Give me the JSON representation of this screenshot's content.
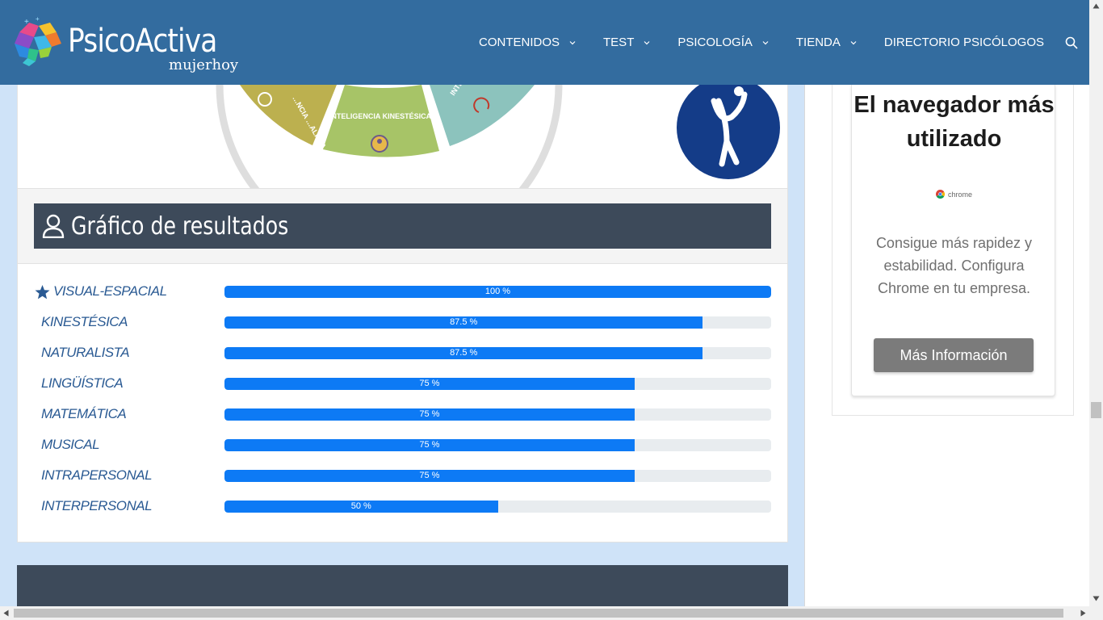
{
  "header": {
    "logo_text": "PsicoActiva",
    "logo_sub": "mujerhoy",
    "nav": [
      {
        "label": "CONTENIDOS",
        "has_dropdown": true
      },
      {
        "label": "TEST",
        "has_dropdown": true
      },
      {
        "label": "PSICOLOGÍA",
        "has_dropdown": true
      },
      {
        "label": "TIENDA",
        "has_dropdown": true
      },
      {
        "label": "DIRECTORIO PSICÓLOGOS",
        "has_dropdown": false
      }
    ],
    "search_icon": "search-icon"
  },
  "image": {
    "wheel_label_left": "…NCIA …ALISTA",
    "wheel_label_center": "INTELIGENCIA KINESTÉSICA",
    "wheel_label_right": "INTE… MUSI…",
    "colors": {
      "olive": "#bcb04f",
      "green": "#a7c467",
      "teal": "#8cc3bd",
      "ring": "#dedede",
      "logo_circle": "#143c88"
    }
  },
  "results": {
    "title": "Gráfico de resultados",
    "title_icon": "user-icon",
    "bar_color": "#0d7af5",
    "rows": [
      {
        "label": "VISUAL-ESPACIAL",
        "value": 100,
        "value_label": "100 %",
        "starred": true
      },
      {
        "label": "KINESTÉSICA",
        "value": 87.5,
        "value_label": "87.5 %",
        "starred": false
      },
      {
        "label": "NATURALISTA",
        "value": 87.5,
        "value_label": "87.5 %",
        "starred": false
      },
      {
        "label": "LINGÜÍSTICA",
        "value": 75,
        "value_label": "75 %",
        "starred": false
      },
      {
        "label": "MATEMÁTICA",
        "value": 75,
        "value_label": "75 %",
        "starred": false
      },
      {
        "label": "MUSICAL",
        "value": 75,
        "value_label": "75 %",
        "starred": false
      },
      {
        "label": "INTRAPERSONAL",
        "value": 75,
        "value_label": "75 %",
        "starred": false
      },
      {
        "label": "INTERPERSONAL",
        "value": 50,
        "value_label": "50 %",
        "starred": false
      }
    ]
  },
  "sidebar": {
    "ad_title": "El navegador más utilizado",
    "ad_brand": "chrome",
    "ad_body": "Consigue más rapidez y estabilidad. Configura Chrome en tu empresa.",
    "ad_button": "Más Información"
  }
}
